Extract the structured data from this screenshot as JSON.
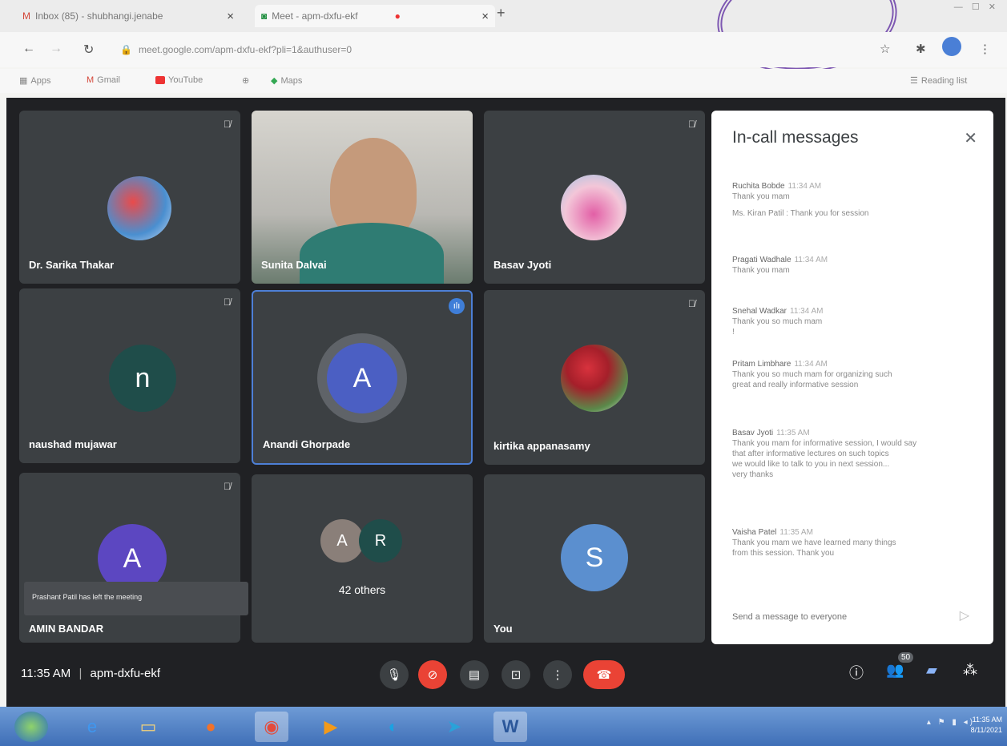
{
  "browser": {
    "tabs": [
      {
        "title": "Inbox (85) - shubhangi.jenabe",
        "icon": "gmail-icon"
      },
      {
        "title": "Meet - apm-dxfu-ekf",
        "icon": "meet-icon"
      }
    ],
    "url": "meet.google.com/apm-dxfu-ekf?pli=1&authuser=0",
    "bookmarks": [
      "Apps",
      "Gmail",
      "YouTube",
      "Maps"
    ],
    "reading_list": "Reading list"
  },
  "participants": [
    {
      "name": "Dr. Sarika Thakar",
      "kind": "photo-avatar",
      "muted": true
    },
    {
      "name": "Sunita Dalvai",
      "kind": "camera",
      "muted": false
    },
    {
      "name": "Basav Jyoti",
      "kind": "photo-avatar",
      "muted": true
    },
    {
      "name": "naushad mujawar",
      "kind": "letter",
      "letter": "n",
      "color": "#1f4d4a",
      "muted": true
    },
    {
      "name": "Anandi Ghorpade",
      "kind": "letter",
      "letter": "A",
      "color": "#4b5fc3",
      "speaking": true
    },
    {
      "name": "kirtika appanasamy",
      "kind": "photo-avatar",
      "muted": true
    },
    {
      "name": "AMIN BANDAR",
      "kind": "letter",
      "letter": "A",
      "color": "#5c47c1",
      "muted": true
    },
    {
      "name": "You",
      "kind": "letter",
      "letter": "S",
      "color": "#5b8fcf"
    }
  ],
  "others_tile": {
    "letters": [
      "A",
      "R"
    ],
    "label": "42 others"
  },
  "toast": "Prashant Patil has left the meeting",
  "chat": {
    "title": "In-call messages",
    "input_placeholder": "Send a message to everyone",
    "messages": [
      {
        "sender": "Ruchita Bobde",
        "time": "11:34 AM",
        "lines": [
          "Thank you mam",
          "Ms. Kiran Patil : Thank you for session"
        ]
      },
      {
        "sender": "Pragati Wadhale",
        "time": "11:34 AM",
        "lines": [
          "Thank you mam"
        ]
      },
      {
        "sender": "Snehal Wadkar",
        "time": "11:34 AM",
        "lines": [
          "Thank you so much mam",
          "!"
        ]
      },
      {
        "sender": "Pritam Limbhare",
        "time": "11:34 AM",
        "lines": [
          "Thank you so much mam for organizing such",
          "great and really informative session"
        ]
      },
      {
        "sender": "Basav Jyoti",
        "time": "11:35 AM",
        "lines": [
          "Thank you mam for informative session, I would say",
          "that after informative lectures on such topics",
          "we would like to talk to you in next session...",
          "very thanks"
        ]
      },
      {
        "sender": "Vaisha Patel",
        "time": "11:35 AM",
        "lines": [
          "Thank you mam we have learned many things",
          "from this session. Thank you"
        ]
      }
    ]
  },
  "meeting": {
    "time": "11:35 AM",
    "code": "apm-dxfu-ekf",
    "people_count": "50"
  },
  "taskbar": {
    "clock_time": "11:35 AM",
    "clock_date": "8/11/2021"
  }
}
